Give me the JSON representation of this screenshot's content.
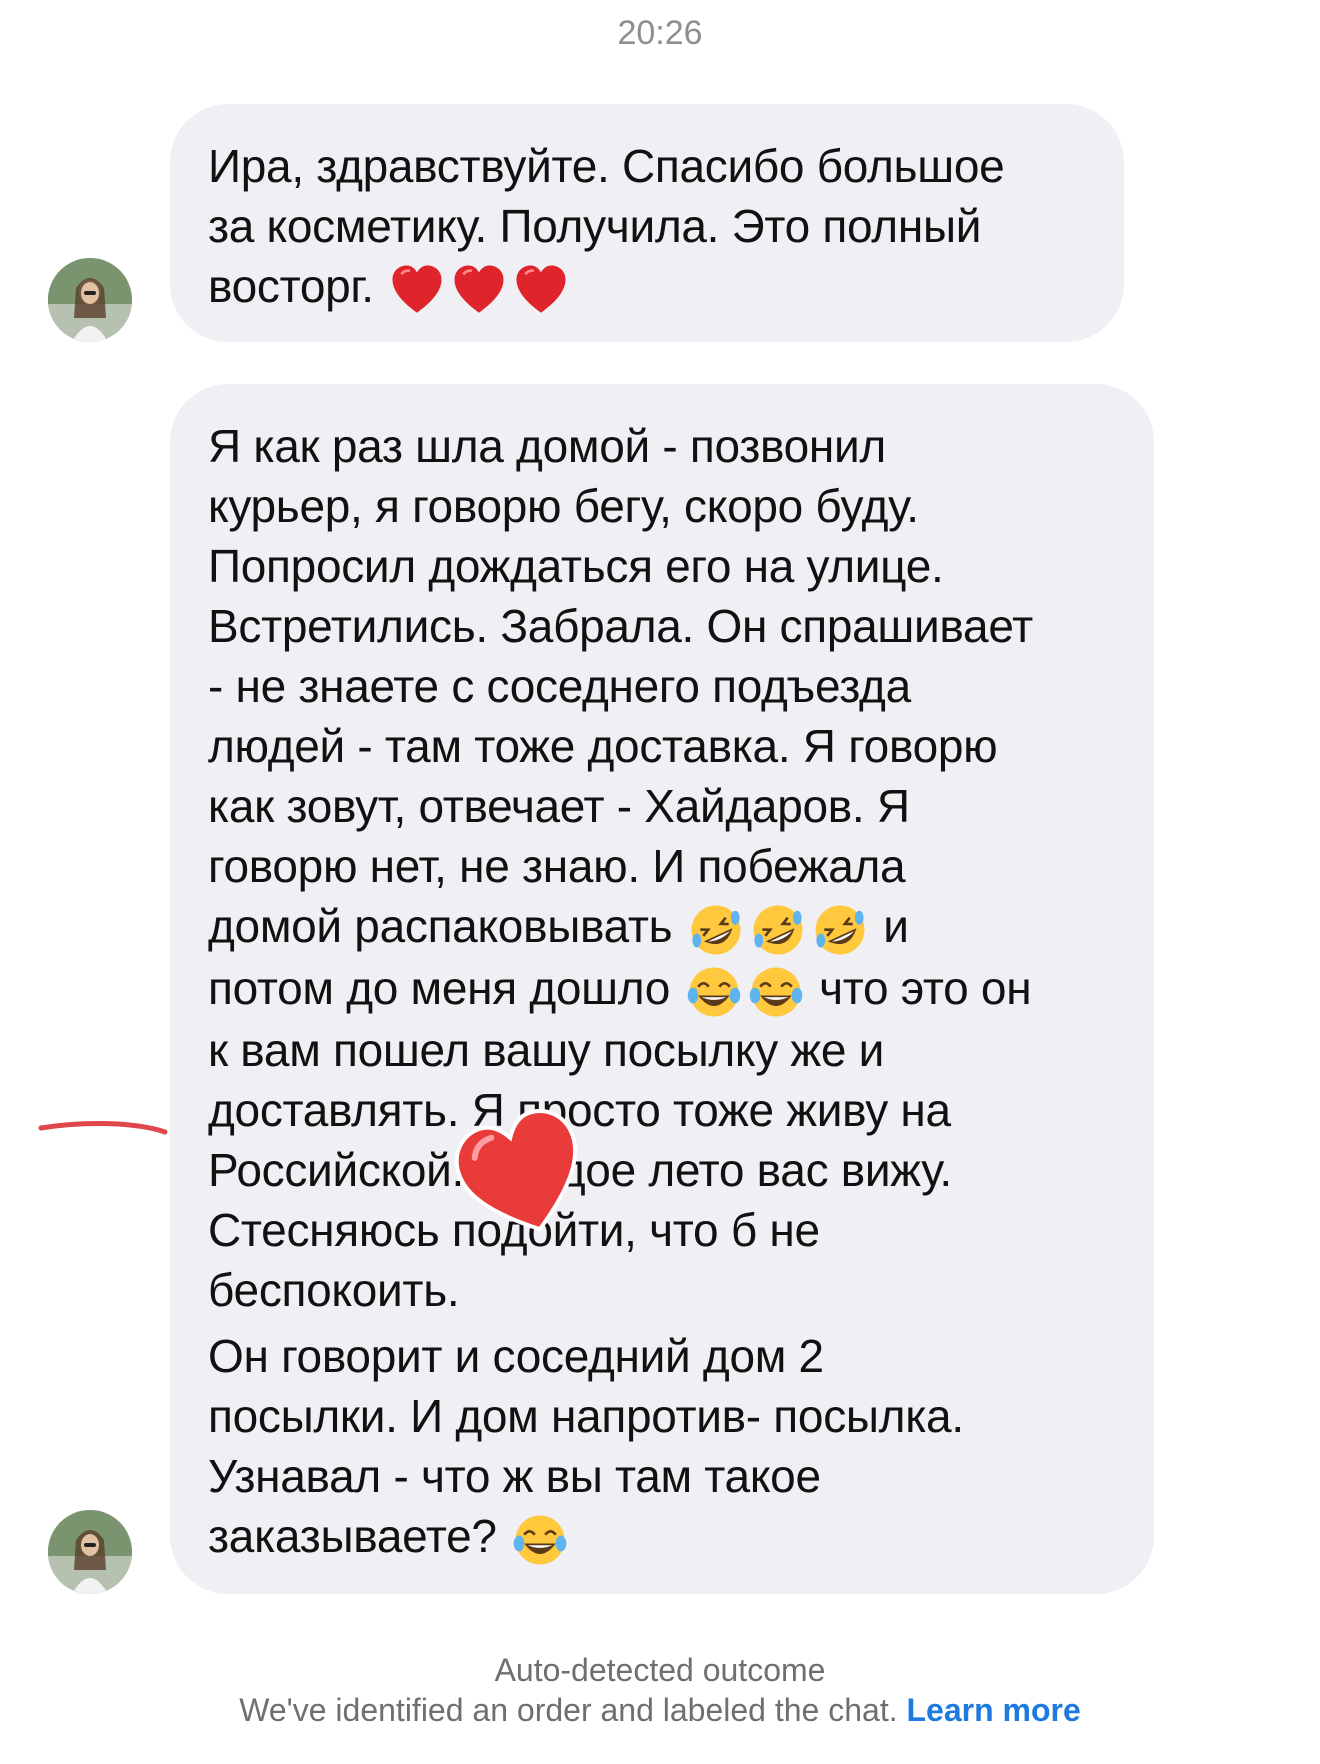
{
  "chat": {
    "timestamp": "20:26",
    "messages": [
      {
        "lines": "Ира, здравствуйте. Спасибо большое\nза косметику. Получила. Это полный\nвосторг. ",
        "emojis": [
          "heart",
          "heart",
          "heart"
        ]
      },
      {
        "part1": "Я как раз шла домой - позвонил\nкурьер, я говорю бегу, скоро буду.\nПопросил дождаться его на улице.\nВстретились. Забрала. Он спрашивает\n- не знаете с соседнего подъезда\nлюдей - там тоже доставка. Я говорю\nкак зовут, отвечает - Хайдаров. Я\nговорю нет, не знаю. И побежала\nдомой распаковывать",
        "part2": "и",
        "part3": "потом до меня дошло",
        "part4": "что это он\nк вам пошел вашу посылку же и\nдоставлять. Я просто тоже живу на\nРоссийской. Каждое лето вас вижу.\nСтесняюсь подойти, что б не\nбеспокоить.",
        "part5": "Он говорит и соседний дом 2\nпосылки. И дом напротив- посылка.\nУзнавал - что ж вы там такое\nзаказываете?",
        "emojis_1": [
          "rofl",
          "rofl",
          "rofl"
        ],
        "emojis_2": [
          "joy",
          "joy"
        ],
        "emojis_3": [
          "joy"
        ]
      }
    ]
  },
  "footer": {
    "title": "Auto-detected outcome",
    "text": "We've identified an order and labeled the chat. ",
    "link": "Learn more"
  },
  "colors": {
    "bubble": "#efeff4",
    "link": "#1f7ae0",
    "muted": "#8e8e93",
    "annotation": "#e0474c"
  }
}
